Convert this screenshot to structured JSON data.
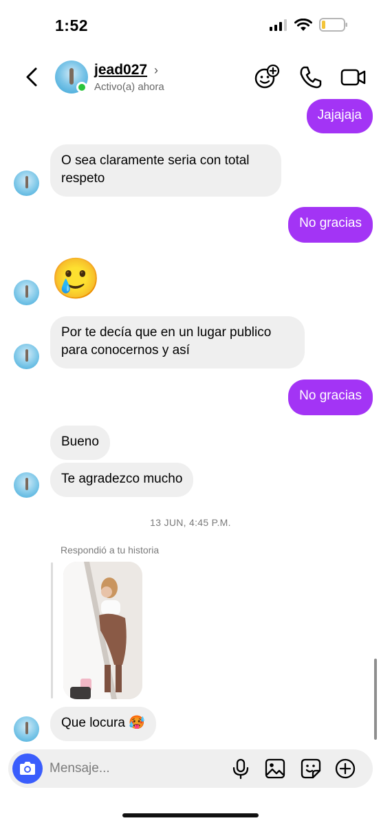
{
  "status_bar": {
    "time": "1:52"
  },
  "header": {
    "username": "jead027",
    "status": "Activo(a) ahora"
  },
  "messages": [
    {
      "from": "me",
      "text": "Jajajaja"
    },
    {
      "from": "them",
      "text": "O sea claramente seria con total respeto"
    },
    {
      "from": "me",
      "text": "No gracias"
    },
    {
      "from": "them",
      "text": "🥲"
    },
    {
      "from": "them",
      "text": "Por te decía que en un lugar publico para conocernos y así"
    },
    {
      "from": "me",
      "text": "No gracias"
    },
    {
      "from": "them",
      "text": "Bueno"
    },
    {
      "from": "them",
      "text": "Te agradezco mucho"
    },
    {
      "from": "them",
      "text": "Que locura 🥵"
    }
  ],
  "timestamp": "13 JUN, 4:45 P.M.",
  "story_reply": {
    "label": "Respondió a tu historia"
  },
  "composer": {
    "placeholder": "Mensaje..."
  },
  "colors": {
    "sent_bubble": "#a334f5",
    "received_bubble": "#efefef",
    "camera_button": "#3a5dfc",
    "online": "#2ac43b"
  },
  "icons": [
    "back-arrow",
    "video-chat-effects",
    "phone",
    "video-camera",
    "camera",
    "microphone",
    "image",
    "sticker",
    "plus"
  ]
}
